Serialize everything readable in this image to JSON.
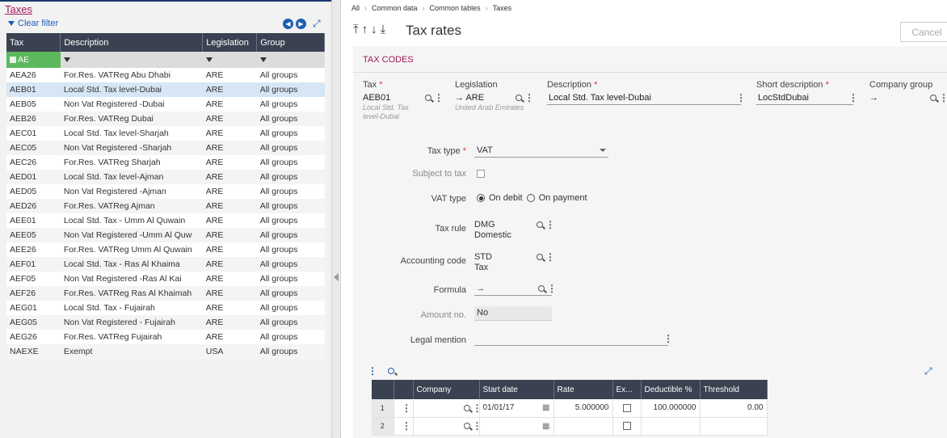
{
  "left": {
    "title": "Taxes",
    "clear_filter": "Clear filter",
    "columns": [
      "Tax",
      "Description",
      "Legislation",
      "Group"
    ],
    "filter_value": "AE",
    "rows": [
      [
        "AEA26",
        "For.Res. VATReg Abu Dhabi",
        "ARE",
        "All groups"
      ],
      [
        "AEB01",
        "Local Std. Tax level-Dubai",
        "ARE",
        "All groups"
      ],
      [
        "AEB05",
        "Non Vat Registered -Dubai",
        "ARE",
        "All groups"
      ],
      [
        "AEB26",
        "For.Res. VATReg Dubai",
        "ARE",
        "All groups"
      ],
      [
        "AEC01",
        "Local Std. Tax level-Sharjah",
        "ARE",
        "All groups"
      ],
      [
        "AEC05",
        "Non Vat Registered -Sharjah",
        "ARE",
        "All groups"
      ],
      [
        "AEC26",
        "For.Res. VATReg Sharjah",
        "ARE",
        "All groups"
      ],
      [
        "AED01",
        "Local Std. Tax level-Ajman",
        "ARE",
        "All groups"
      ],
      [
        "AED05",
        "Non Vat Registered -Ajman",
        "ARE",
        "All groups"
      ],
      [
        "AED26",
        "For.Res. VATReg Ajman",
        "ARE",
        "All groups"
      ],
      [
        "AEE01",
        "Local Std. Tax - Umm Al Quwain",
        "ARE",
        "All groups"
      ],
      [
        "AEE05",
        "Non Vat Registered -Umm Al Quw",
        "ARE",
        "All groups"
      ],
      [
        "AEE26",
        "For.Res. VATReg Umm Al Quwain",
        "ARE",
        "All groups"
      ],
      [
        "AEF01",
        "Local Std. Tax - Ras Al Khaima",
        "ARE",
        "All groups"
      ],
      [
        "AEF05",
        "Non Vat Registered -Ras Al Kai",
        "ARE",
        "All groups"
      ],
      [
        "AEF26",
        "For.Res. VATReg Ras Al Khaimah",
        "ARE",
        "All groups"
      ],
      [
        "AEG01",
        "Local Std. Tax - Fujairah",
        "ARE",
        "All groups"
      ],
      [
        "AEG05",
        "Non Vat Registered - Fujairah",
        "ARE",
        "All groups"
      ],
      [
        "AEG26",
        "For.Res. VATReg Fujairah",
        "ARE",
        "All groups"
      ],
      [
        "NAEXE",
        "Exempt",
        "USA",
        "All groups"
      ]
    ],
    "selected_index": 1
  },
  "breadcrumb": [
    "All",
    "Common data",
    "Common tables",
    "Taxes"
  ],
  "toolbar": {
    "arrows": "⤒↑↓⤓"
  },
  "page_title": "Tax rates",
  "cancel_label": "Cancel",
  "section_title": "TAX CODES",
  "fields": {
    "tax": {
      "label": "Tax",
      "value": "AEB01",
      "sub": "Local Std. Tax level-Dubai"
    },
    "legislation": {
      "label": "Legislation",
      "value": "ARE",
      "sub": "United Arab Emirates"
    },
    "description": {
      "label": "Description",
      "value": "Local Std. Tax level-Dubai"
    },
    "short_description": {
      "label": "Short description",
      "value": "LocStdDubai"
    },
    "company_group": {
      "label": "Company group",
      "value": ""
    },
    "tax_type": {
      "label": "Tax type",
      "value": "VAT"
    },
    "subject_to_tax": {
      "label": "Subject to tax"
    },
    "vat_type": {
      "label": "VAT type",
      "opt1": "On debit",
      "opt2": "On payment"
    },
    "tax_rule": {
      "label": "Tax rule",
      "value": "DMG",
      "sub": "Domestic"
    },
    "accounting_code": {
      "label": "Accounting code",
      "value": "STD",
      "sub": "Tax"
    },
    "formula": {
      "label": "Formula",
      "value": ""
    },
    "amount_no": {
      "label": "Amount no.",
      "value": "No"
    },
    "legal_mention": {
      "label": "Legal mention",
      "value": ""
    }
  },
  "rates_grid": {
    "columns": [
      "Company",
      "Start date",
      "Rate",
      "Ex...",
      "Deductible %",
      "Threshold"
    ],
    "rows": [
      {
        "num": "1",
        "company": "",
        "start_date": "01/01/17",
        "rate": "5.000000",
        "deductible": "100.000000",
        "threshold": "0.00"
      },
      {
        "num": "2",
        "company": "",
        "start_date": "",
        "rate": "",
        "deductible": "",
        "threshold": ""
      }
    ]
  }
}
